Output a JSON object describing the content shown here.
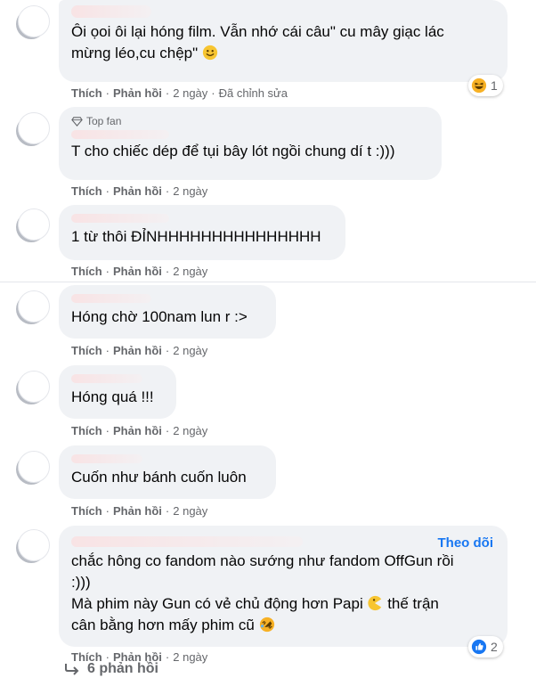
{
  "actions": {
    "like": "Thích",
    "reply": "Phản hồi",
    "dot": "·"
  },
  "comments": [
    {
      "text_line1": "Ôi ọoi ôi lại hóng film. Vẫn nhớ cái câu\" cu mây giạc lác",
      "text_line2": "mừng léo,cu chệp\"",
      "time": "2 ngày",
      "edited": "Đã chỉnh sửa",
      "reaction_count": "1"
    },
    {
      "badge": "Top fan",
      "text": "T cho chiếc dép để tụi bây lót ngồi chung dí t :)))",
      "time": "2 ngày"
    },
    {
      "text": "1 từ thôi ĐỈNHHHHHHHHHHHHHHH",
      "time": "2 ngày"
    },
    {
      "text": "Hóng chờ 100nam lun r :>",
      "time": "2 ngày"
    },
    {
      "text": "Hóng quá !!!",
      "time": "2 ngày"
    },
    {
      "text": "Cuốn như bánh cuốn luôn",
      "time": "2 ngày"
    },
    {
      "follow": "Theo dõi",
      "text_line1": "chắc hông co fandom nào sướng như fandom OffGun rồi",
      "text_line2": ":)))",
      "text_line3a": "Mà phim này Gun có vẻ chủ động hơn Papi",
      "text_line3b": "thế trận",
      "text_line4": "cân bằng hơn mấy phim cũ",
      "time": "2 ngày",
      "reaction_count": "2"
    }
  ],
  "replies_label": "6 phản hồi",
  "colors": {
    "bubble": "#f0f2f5",
    "meta": "#65676b",
    "link": "#1877f2",
    "like_blue": "#1877f2",
    "haha_yellow": "#f7b125"
  }
}
